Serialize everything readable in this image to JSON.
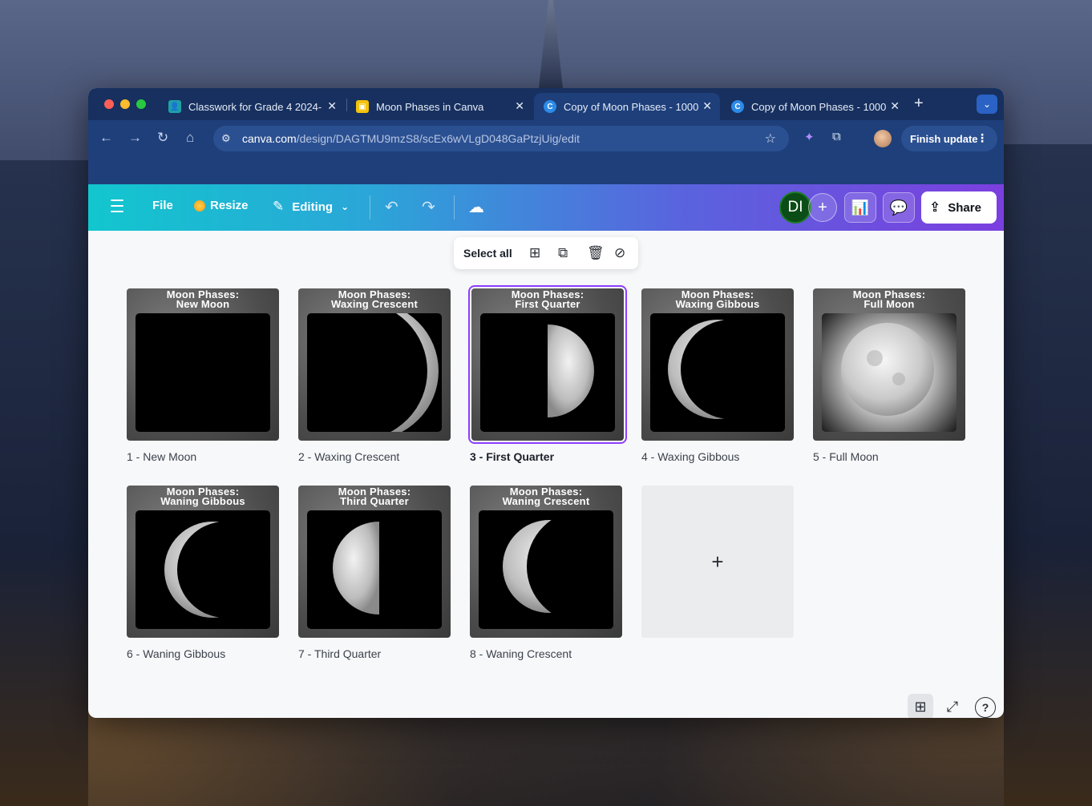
{
  "browser": {
    "tabs": [
      {
        "title": "Classwork for Grade 4 2024-",
        "fav_color": "#1fa0a8",
        "fav_glyph": "👤"
      },
      {
        "title": "Moon Phases in Canva",
        "fav_color": "#f4c20d",
        "fav_glyph": "▣"
      },
      {
        "title": "Copy of Moon Phases - 1000",
        "fav_color": "#2c8ae8",
        "fav_glyph": "C"
      },
      {
        "title": "Copy of Moon Phases - 1000",
        "fav_color": "#2c8ae8",
        "fav_glyph": "C"
      }
    ],
    "close_glyph": "✕",
    "newtab_glyph": "+",
    "tabmenu_glyph": "⌄",
    "url_host": "canva.com",
    "url_path": "/design/DAGTMU9mzS8/scEx6wVLgD048GaPtzjUig/edit",
    "finish_update_label": "Finish update"
  },
  "canva": {
    "file_label": "File",
    "resize_label": "Resize",
    "editing_label": "Editing",
    "avatar_initials": "DI",
    "share_label": "Share",
    "select_all_label": "Select all",
    "accent_color": "#8b3dff"
  },
  "pages": [
    {
      "hdr1": "Moon Phases:",
      "hdr2": "New Moon",
      "label": "1 - New Moon",
      "selected": false
    },
    {
      "hdr1": "Moon Phases:",
      "hdr2": "Waxing Crescent",
      "label": "2 - Waxing Crescent",
      "selected": false
    },
    {
      "hdr1": "Moon Phases:",
      "hdr2": "First Quarter",
      "label": "3 - First Quarter",
      "selected": true
    },
    {
      "hdr1": "Moon Phases:",
      "hdr2": "Waxing Gibbous",
      "label": "4 - Waxing Gibbous",
      "selected": false
    },
    {
      "hdr1": "Moon Phases:",
      "hdr2": "Full Moon",
      "label": "5 - Full Moon",
      "selected": false
    },
    {
      "hdr1": "Moon Phases:",
      "hdr2": "Waning Gibbous",
      "label": "6 - Waning Gibbous",
      "selected": false
    },
    {
      "hdr1": "Moon Phases:",
      "hdr2": "Third Quarter",
      "label": "7 - Third Quarter",
      "selected": false
    },
    {
      "hdr1": "Moon Phases:",
      "hdr2": "Waning Crescent",
      "label": "8 - Waning Crescent",
      "selected": false
    }
  ],
  "add_page_glyph": "+"
}
